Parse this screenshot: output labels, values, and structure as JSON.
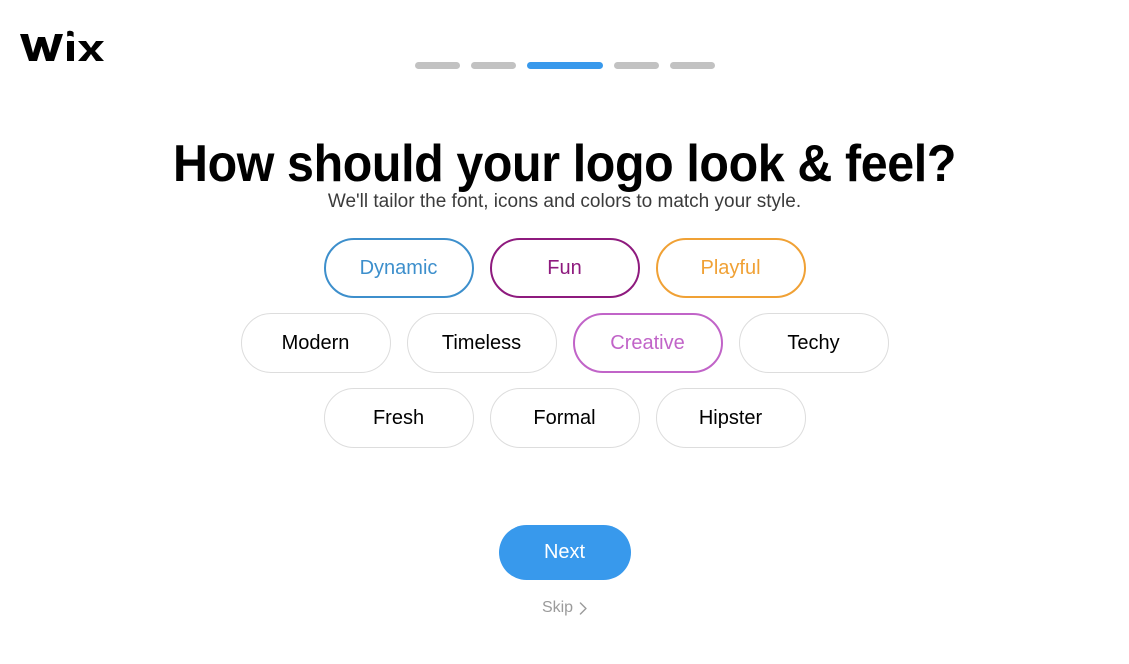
{
  "brand": {
    "logo_text": "WiX",
    "logo_icon": "wix-logo"
  },
  "progress": {
    "total_steps": 5,
    "current_step": 3,
    "active_color": "#3899ec",
    "inactive_color": "#c2c2c2",
    "steps": [
      {
        "index": 1,
        "active": false
      },
      {
        "index": 2,
        "active": false
      },
      {
        "index": 3,
        "active": true
      },
      {
        "index": 4,
        "active": false
      },
      {
        "index": 5,
        "active": false
      }
    ]
  },
  "header": {
    "title": "How should your logo look & feel?",
    "subtitle": "We'll tailor the font, icons and colors to match your style."
  },
  "chips": {
    "rows": [
      [
        {
          "label": "Dynamic",
          "selected": true,
          "color": "#3d8fcc"
        },
        {
          "label": "Fun",
          "selected": true,
          "color": "#8e1a7e"
        },
        {
          "label": "Playful",
          "selected": true,
          "color": "#f0a135"
        }
      ],
      [
        {
          "label": "Modern",
          "selected": false,
          "color": "#000000"
        },
        {
          "label": "Timeless",
          "selected": false,
          "color": "#000000"
        },
        {
          "label": "Creative",
          "selected": true,
          "color": "#c164c8"
        },
        {
          "label": "Techy",
          "selected": false,
          "color": "#000000"
        }
      ],
      [
        {
          "label": "Fresh",
          "selected": false,
          "color": "#000000"
        },
        {
          "label": "Formal",
          "selected": false,
          "color": "#000000"
        },
        {
          "label": "Hipster",
          "selected": false,
          "color": "#000000"
        }
      ]
    ]
  },
  "footer": {
    "next_label": "Next",
    "skip_label": "Skip",
    "skip_icon": "chevron-right-icon",
    "next_color": "#3899ec"
  }
}
